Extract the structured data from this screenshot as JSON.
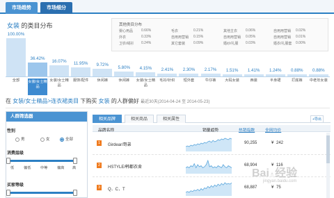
{
  "top_tabs": [
    "市场趋势",
    "市场细分"
  ],
  "category_section": {
    "title_highlight": "女装",
    "title_rest": "的类目分布"
  },
  "other_panel": {
    "header": "其他类目分布",
    "items": [
      {
        "name": "婴心用品",
        "pct": "0.66%"
      },
      {
        "name": "毛衣",
        "pct": "0.21%"
      },
      {
        "name": "其他主衣",
        "pct": "0.06%"
      },
      {
        "name": "自用用营销",
        "pct": "0.02%"
      },
      {
        "name": "外衣",
        "pct": "0.33%"
      },
      {
        "name": "自用用营销",
        "pct": "0.15%"
      },
      {
        "name": "自用用营销",
        "pct": "0.05%"
      },
      {
        "name": "自用用营销",
        "pct": "0.01%"
      },
      {
        "name": "卫衣/绒衫",
        "pct": "0.24%"
      },
      {
        "name": "其它套装",
        "pct": "0.09%"
      },
      {
        "name": "婚纱/礼服",
        "pct": "0.03%"
      },
      {
        "name": "婚衣/礼服套",
        "pct": "0.00%"
      }
    ]
  },
  "chart_data": {
    "type": "bar",
    "categories": [
      "全部",
      "女装/女士精品",
      "女装/女士精品",
      "服饰/配件",
      "休闲裤",
      "休闲裤",
      "女装/女士精品",
      "毛衫/针织",
      "短外套",
      "牛仔裤",
      "大码女装",
      "西装",
      "半身裙",
      "打底裤",
      "中老年女装"
    ],
    "values": [
      100.0,
      36.42,
      16.07,
      11.95,
      9.72,
      5.8,
      4.15,
      2.41,
      2.3,
      2.17,
      1.51,
      1.41,
      1.24,
      0.88,
      0.88
    ],
    "labels": [
      "100.00%",
      "36.42%",
      "16.07%",
      "11.95%",
      "9.72%",
      "5.80%",
      "4.15%",
      "2.41%",
      "2.30%",
      "2.17%",
      "1.51%",
      "1.41%",
      "1.24%",
      "0.88%",
      "0.88%"
    ],
    "selected_index": 1,
    "ylim": [
      0,
      100
    ]
  },
  "pref_header": {
    "prefix": "在",
    "path": "女装/女士精品>连衣裙类目",
    "mid": "下购买",
    "highlight": "女装",
    "suffix": "的人群偏好",
    "daterange": "最近30天(2014-04-24 至 2014-05-23)"
  },
  "filter": {
    "title": "人群筛选器",
    "gender_label": "性别",
    "gender_options": [
      "男",
      "女",
      "全部"
    ],
    "consumption_label": "消费层级",
    "consumption_ticks": [
      "低",
      "偏低",
      "中等",
      "偏高",
      "高"
    ],
    "buyer_label": "买家等级"
  },
  "table": {
    "tabs": [
      "相关品牌",
      "相关商品",
      "相关属性"
    ],
    "export_label": "+导出",
    "columns": [
      "品牌名称",
      "销量趋势",
      "热销指数",
      "全网均价"
    ],
    "rows": [
      {
        "rank": "1",
        "brand": "Girdear/哥弟",
        "trend": [
          6,
          7,
          6,
          8,
          7,
          9,
          8,
          10,
          9,
          11,
          10,
          12,
          11,
          13,
          14,
          12,
          15,
          13,
          14,
          16,
          15,
          17,
          16,
          18,
          17,
          16,
          18,
          17
        ],
        "hot": "90,255",
        "price": "¥",
        "amount": "242"
      },
      {
        "rank": "2",
        "brand": "HSTYLE/韩都衣舍",
        "trend": [
          5,
          6,
          5,
          7,
          6,
          9,
          5,
          8,
          6,
          7,
          5,
          6,
          8,
          12,
          6,
          7,
          5,
          6,
          5,
          7,
          6,
          5,
          8,
          6,
          5,
          7,
          6,
          5
        ],
        "hot": "68,904",
        "price": "¥",
        "amount": "116"
      },
      {
        "rank": "3",
        "brand": "Q．C．T",
        "trend": [
          4,
          5,
          4,
          6,
          5,
          7,
          6,
          8,
          6,
          9,
          7,
          10,
          9,
          12,
          10,
          13,
          11,
          14,
          12,
          15,
          13,
          16,
          14,
          17,
          15,
          16,
          15,
          17
        ],
        "hot": "68,887",
        "price": "¥",
        "amount": "75"
      }
    ]
  },
  "watermark": {
    "logo": "Bai♁经验",
    "url": "jingyan.baidu.com"
  }
}
